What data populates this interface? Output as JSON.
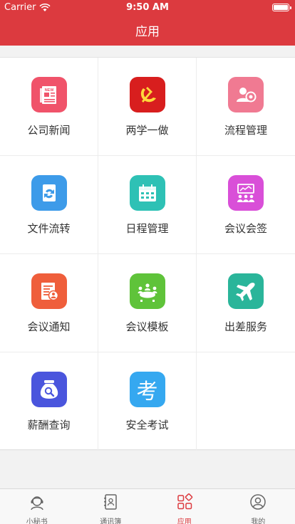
{
  "status_bar": {
    "carrier": "Carrier",
    "time": "9:50 AM",
    "battery_level": 0.9
  },
  "nav": {
    "title": "应用"
  },
  "apps": [
    {
      "label": "公司新闻",
      "icon": "newspaper-icon",
      "color": "#f0536a"
    },
    {
      "label": "两学一做",
      "icon": "party-emblem-icon",
      "color": "#d81e1e"
    },
    {
      "label": "流程管理",
      "icon": "user-gear-icon",
      "color": "#f07a92"
    },
    {
      "label": "文件流转",
      "icon": "file-transfer-icon",
      "color": "#3d9be9"
    },
    {
      "label": "日程管理",
      "icon": "calendar-icon",
      "color": "#2ec1b5"
    },
    {
      "label": "会议会签",
      "icon": "meeting-sign-icon",
      "color": "#d94fd8"
    },
    {
      "label": "会议通知",
      "icon": "notice-icon",
      "color": "#ef5e3b"
    },
    {
      "label": "会议模板",
      "icon": "meeting-table-icon",
      "color": "#5fc33a"
    },
    {
      "label": "出差服务",
      "icon": "airplane-icon",
      "color": "#2ab59a"
    },
    {
      "label": "薪酬查询",
      "icon": "money-search-icon",
      "color": "#4a55dd"
    },
    {
      "label": "安全考试",
      "icon": "exam-icon",
      "color": "#35a8f0",
      "glyph": "考"
    }
  ],
  "tabs": [
    {
      "label": "小秘书",
      "icon": "assistant-icon",
      "active": false
    },
    {
      "label": "通讯簿",
      "icon": "contacts-icon",
      "active": false
    },
    {
      "label": "应用",
      "icon": "apps-icon",
      "active": true
    },
    {
      "label": "我的",
      "icon": "profile-icon",
      "active": false
    }
  ],
  "colors": {
    "brand_red": "#dc3a3f",
    "tab_inactive": "#666666"
  }
}
